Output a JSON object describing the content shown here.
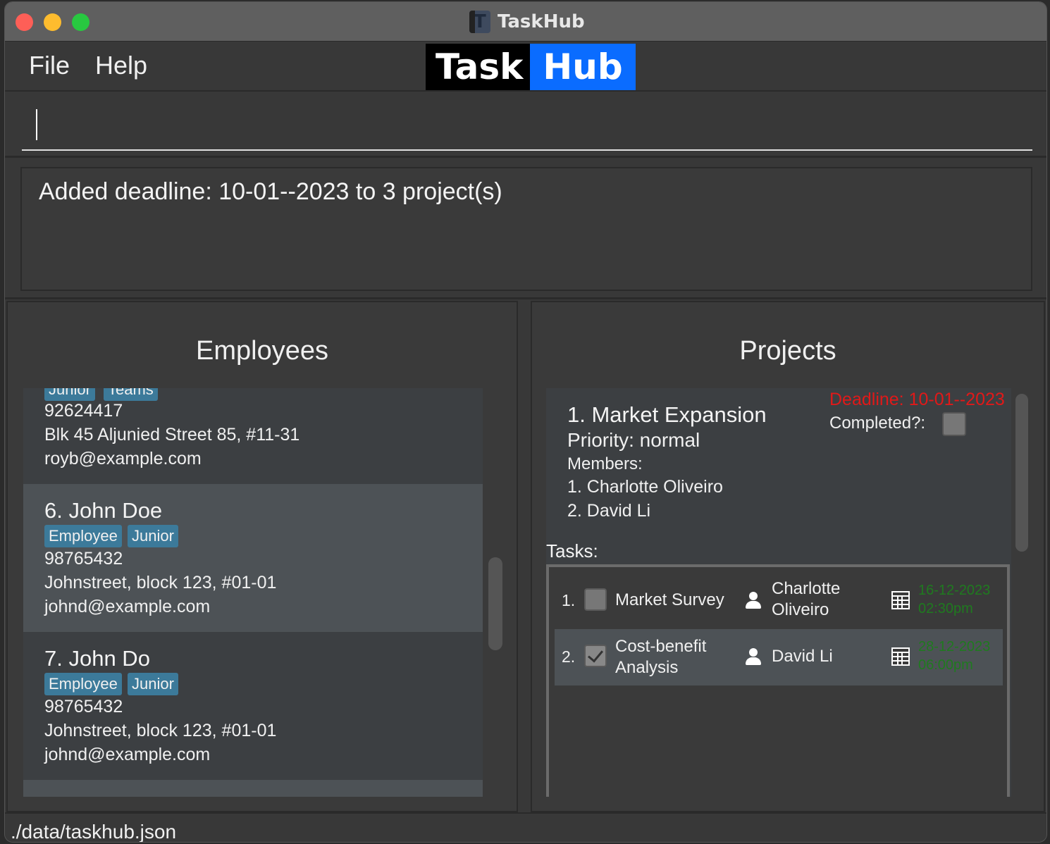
{
  "window": {
    "title": "TaskHub"
  },
  "menu": {
    "file": "File",
    "help": "Help"
  },
  "logo": {
    "task": "Task",
    "hub": "Hub"
  },
  "command": {
    "value": "",
    "placeholder": ""
  },
  "result": {
    "text": "Added deadline: 10-01--2023 to 3 project(s)"
  },
  "employees": {
    "title": "Employees",
    "cards": [
      {
        "tags": [
          "Junior",
          "Teams"
        ],
        "phone": "92624417",
        "address": "Blk 45 Aljunied Street 85, #11-31",
        "email": "royb@example.com"
      },
      {
        "name": "6.  John Doe",
        "tags": [
          "Employee",
          "Junior"
        ],
        "phone": "98765432",
        "address": "Johnstreet, block 123, #01-01",
        "email": "johnd@example.com"
      },
      {
        "name": "7.  John Do",
        "tags": [
          "Employee",
          "Junior"
        ],
        "phone": "98765432",
        "address": "Johnstreet, block 123, #01-01",
        "email": "johnd@example.com"
      }
    ]
  },
  "projects": {
    "title": "Projects",
    "card": {
      "name": "1.  Market Expansion",
      "priority": "Priority: normal",
      "members_label": "Members:",
      "members": [
        "1. Charlotte Oliveiro",
        "2. David Li"
      ],
      "deadline": "Deadline: 10-01--2023",
      "completed_label": "Completed?:",
      "tasks_label": "Tasks:",
      "tasks": [
        {
          "num": "1.",
          "name_line1": "Market Survey",
          "name_line2": "",
          "assignee_line1": "Charlotte",
          "assignee_line2": "Oliveiro",
          "date": "16-12-2023",
          "time": "02:30pm",
          "done": false
        },
        {
          "num": "2.",
          "name_line1": "Cost-benefit",
          "name_line2": "Analysis",
          "assignee_line1": "David Li",
          "assignee_line2": "",
          "date": "28-12-2023",
          "time": "06:00pm",
          "done": true
        }
      ]
    }
  },
  "status": {
    "path": "./data/taskhub.json"
  },
  "colors": {
    "accent": "#0a6cff",
    "tag": "#3c7a9a",
    "deadline": "#e01919",
    "due": "#1f7a1f"
  }
}
